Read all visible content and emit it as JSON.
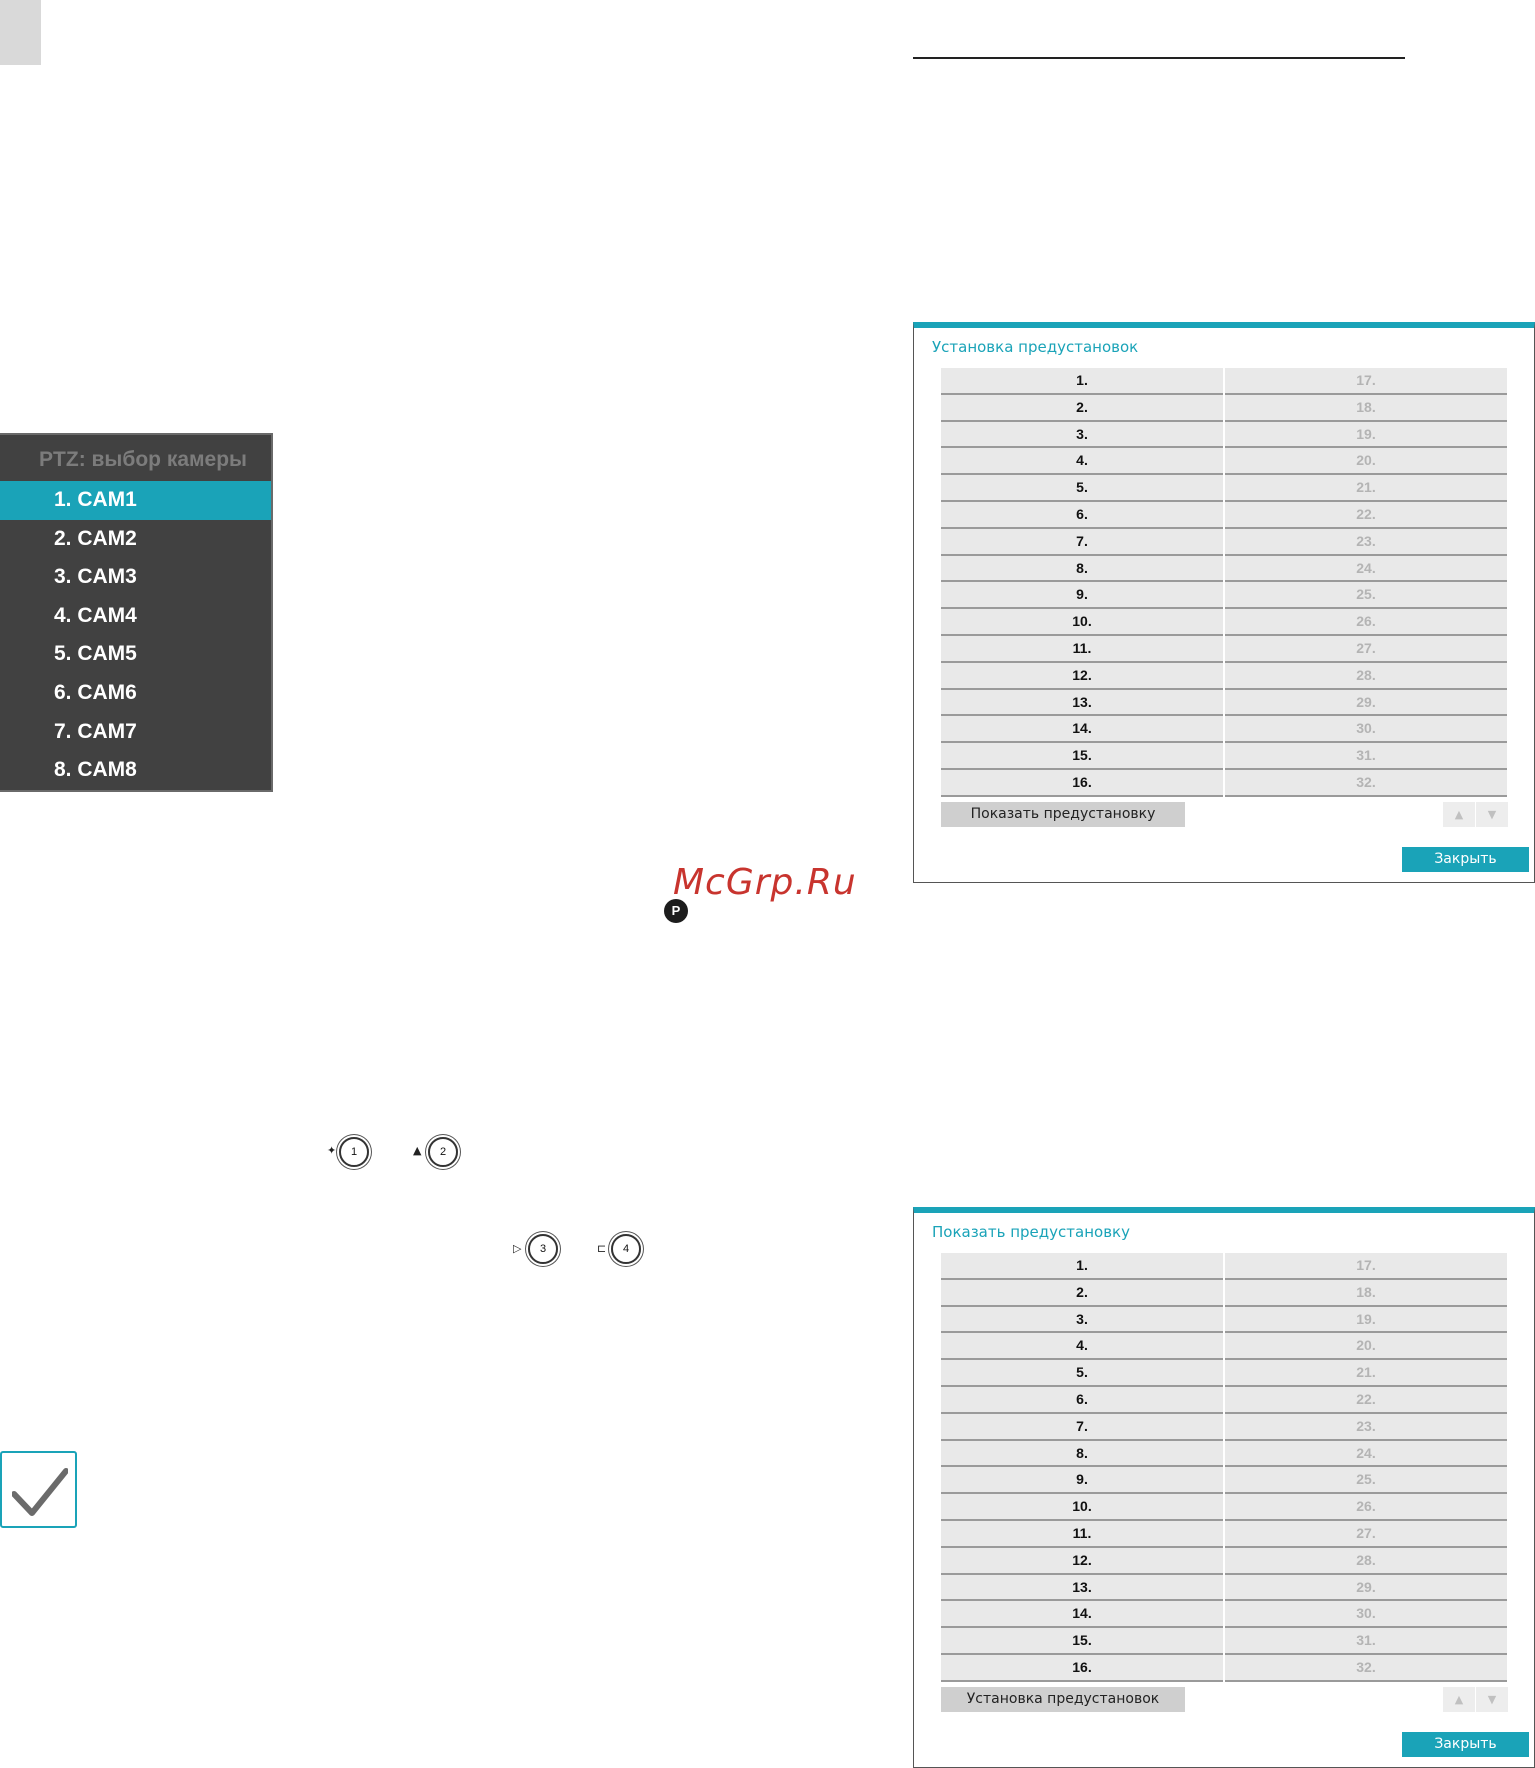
{
  "ptz_menu": {
    "title": "PTZ: выбор камеры",
    "items": [
      "1. CAM1",
      "2. CAM2",
      "3. CAM3",
      "4. CAM4",
      "5. CAM5",
      "6. CAM6",
      "7. CAM7",
      "8. CAM8"
    ],
    "selected_index": 0
  },
  "preset_setup_dialog": {
    "title": "Установка предустановок",
    "left_column": [
      "1.",
      "2.",
      "3.",
      "4.",
      "5.",
      "6.",
      "7.",
      "8.",
      "9.",
      "10.",
      "11.",
      "12.",
      "13.",
      "14.",
      "15.",
      "16."
    ],
    "right_column": [
      "17.",
      "18.",
      "19.",
      "20.",
      "21.",
      "22.",
      "23.",
      "24.",
      "25.",
      "26.",
      "27.",
      "28.",
      "29.",
      "30.",
      "31.",
      "32."
    ],
    "mode_button": "Показать предустановку",
    "close_button": "Закрыть"
  },
  "preset_view_dialog": {
    "title": "Показать предустановку",
    "left_column": [
      "1.",
      "2.",
      "3.",
      "4.",
      "5.",
      "6.",
      "7.",
      "8.",
      "9.",
      "10.",
      "11.",
      "12.",
      "13.",
      "14.",
      "15.",
      "16."
    ],
    "right_column": [
      "17.",
      "18.",
      "19.",
      "20.",
      "21.",
      "22.",
      "23.",
      "24.",
      "25.",
      "26.",
      "27.",
      "28.",
      "29.",
      "30.",
      "31.",
      "32."
    ],
    "mode_button": "Установка предустановок",
    "close_button": "Закрыть"
  },
  "watermark": "McGrp.Ru",
  "icons": {
    "preset_key": "P",
    "buttons": [
      "1",
      "2",
      "3",
      "4"
    ],
    "check": "checkmark-icon"
  },
  "colors": {
    "accent": "#1aa3b8",
    "menu_bg": "#414141",
    "watermark": "#c8342e"
  }
}
